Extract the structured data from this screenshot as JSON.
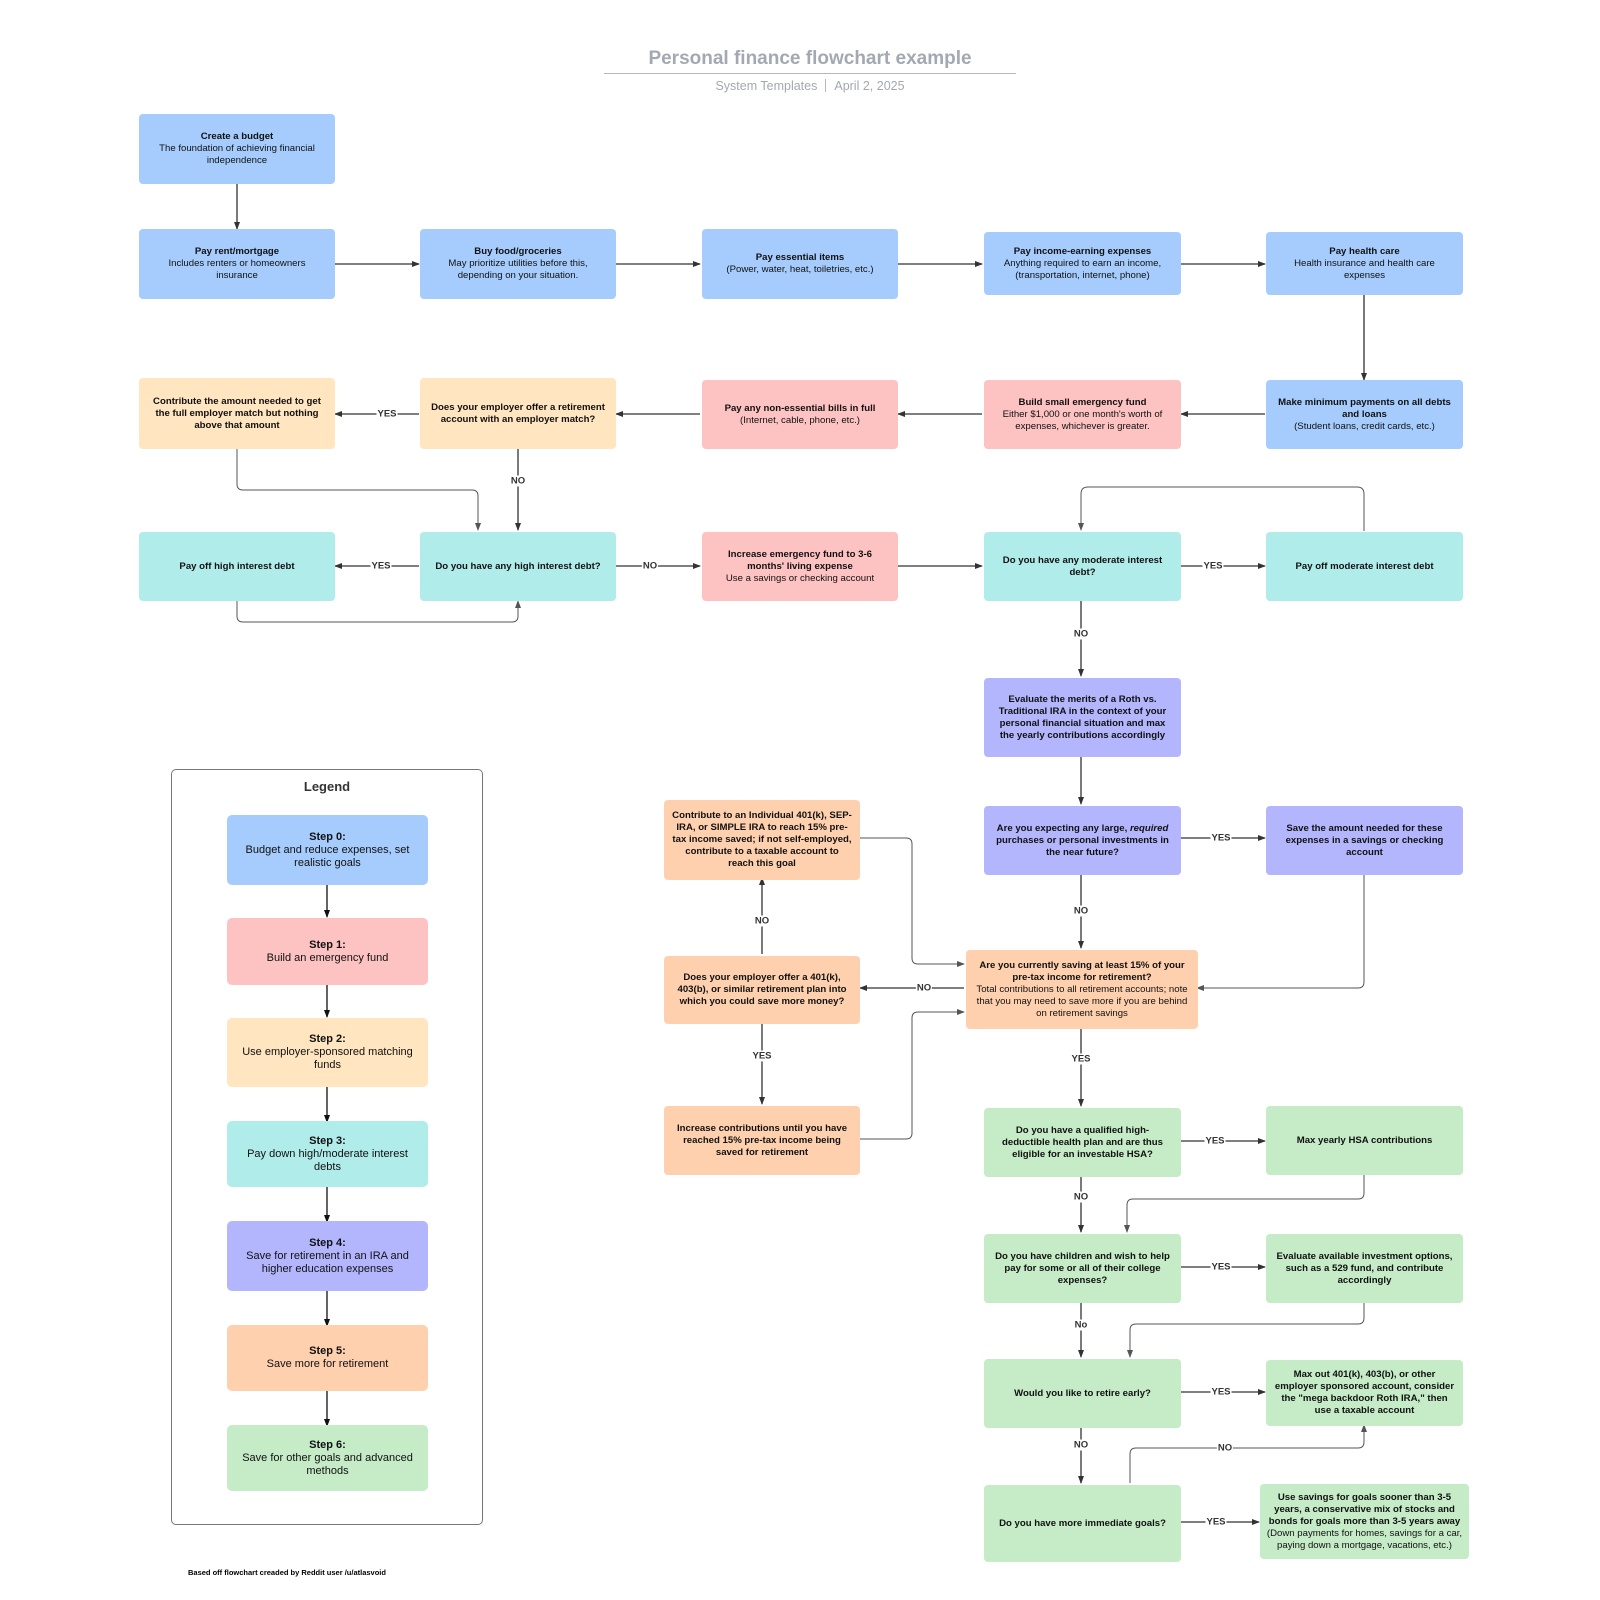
{
  "header": {
    "title": "Personal finance flowchart example",
    "owner": "System Templates",
    "date": "April 2, 2025"
  },
  "nodes": {
    "budget": {
      "title": "Create a budget",
      "desc": "The foundation of achieving financial independence"
    },
    "rent": {
      "title": "Pay rent/mortgage",
      "desc": "Includes renters or homeowners insurance"
    },
    "food": {
      "title": "Buy food/groceries",
      "desc": "May prioritize utilities before this, depending on your situation."
    },
    "essential": {
      "title": "Pay essential items",
      "desc": "(Power, water, heat, toiletries, etc.)"
    },
    "income": {
      "title": "Pay income-earning expenses",
      "desc": "Anything required to earn an income, (transportation, internet, phone)"
    },
    "health": {
      "title": "Pay health care",
      "desc": "Health insurance and health care expenses"
    },
    "minpay": {
      "title": "Make minimum payments on all debts and loans",
      "desc": "(Student loans, credit cards, etc.)"
    },
    "smallfund": {
      "title": "Build small emergency fund",
      "desc": "Either $1,000 or one month's worth of expenses, whichever is greater."
    },
    "nonessential": {
      "title": "Pay any non-essential bills in full",
      "desc": "(Internet, cable, phone, etc.)"
    },
    "employer_match_q": {
      "title": "Does your employer offer a retirement account with an employer match?"
    },
    "contribute_match": {
      "title": "Contribute the amount needed to get the full employer match but nothing above that amount"
    },
    "high_debt_q": {
      "title": "Do you have any high interest debt?"
    },
    "payoff_high": {
      "title": "Pay off high interest debt"
    },
    "increase_fund": {
      "title": "Increase emergency fund to 3-6 months' living expense",
      "desc": "Use a savings or checking account"
    },
    "moderate_debt_q": {
      "title": "Do you have any moderate interest debt?"
    },
    "payoff_moderate": {
      "title": "Pay off moderate interest debt"
    },
    "roth_ira": {
      "title": "Evaluate the merits of a Roth vs. Traditional IRA in the context of your personal financial situation and max the yearly contributions accordingly"
    },
    "large_purchases_q": {
      "title_a": "Are you expecting any large, ",
      "title_em": "required",
      "title_b": " purchases or personal investments in the near future?"
    },
    "save_expenses": {
      "title": "Save the amount needed for these expenses in a savings or checking account"
    },
    "saving15_q": {
      "title": "Are you currently saving at least 15% of your pre-tax income for retirement?",
      "desc": "Total contributions to all retirement accounts; note that you may need to save more if you are behind on retirement savings"
    },
    "individual401k": {
      "title": "Contribute to an Individual 401(k), SEP-IRA, or SIMPLE IRA to reach 15% pre-tax income saved; if not self-employed, contribute to a taxable account to reach this goal"
    },
    "employer401k_q": {
      "title": "Does your employer offer a 401(k), 403(b), or similar retirement plan into which you could save more money?"
    },
    "increase_contrib": {
      "title": "Increase contributions until you have reached 15% pre-tax income being saved for retirement"
    },
    "hsa_q": {
      "title": "Do you have a qualified high-deductible health plan and are thus eligible for an investable HSA?"
    },
    "max_hsa": {
      "title": "Max yearly HSA contributions"
    },
    "children_q": {
      "title": "Do you have children and wish to help pay for some or all of their college expenses?"
    },
    "eval_529": {
      "title": "Evaluate available investment options, such as a 529 fund, and contribute accordingly"
    },
    "retire_early_q": {
      "title": "Would you like to retire early?"
    },
    "mega_backdoor": {
      "title": "Max out 401(k), 403(b), or other employer sponsored account, consider the \"mega backdoor Roth IRA,\" then use a taxable account"
    },
    "immediate_goals_q": {
      "title": "Do you have more immediate goals?"
    },
    "use_savings": {
      "title": "Use savings for goals sooner than 3-5 years, a conservative mix of stocks and bonds for goals more than 3-5 years away",
      "desc": "(Down payments for homes, savings for a car, paying down a mortgage, vacations, etc.)"
    }
  },
  "edge_labels": {
    "yes": "YES",
    "no": "NO",
    "no_lower": "No"
  },
  "legend": {
    "title": "Legend",
    "steps": [
      {
        "title": "Step 0:",
        "desc": "Budget and reduce expenses, set realistic goals",
        "color": "#a5ccfc"
      },
      {
        "title": "Step 1:",
        "desc": "Build an emergency fund",
        "color": "#fdc2c2"
      },
      {
        "title": "Step 2:",
        "desc": "Use employer-sponsored matching funds",
        "color": "#ffe5c0"
      },
      {
        "title": "Step 3:",
        "desc": "Pay down high/moderate interest debts",
        "color": "#b0ecea"
      },
      {
        "title": "Step 4:",
        "desc": "Save for retirement in an IRA and higher education expenses",
        "color": "#b3b6fd"
      },
      {
        "title": "Step 5:",
        "desc": "Save more for retirement",
        "color": "#fed0ae"
      },
      {
        "title": "Step 6:",
        "desc": "Save for other goals and advanced methods",
        "color": "#c5ebc7"
      }
    ]
  },
  "footnote": "Based off flowchart creaded by Reddit user /u/atlasvoid"
}
